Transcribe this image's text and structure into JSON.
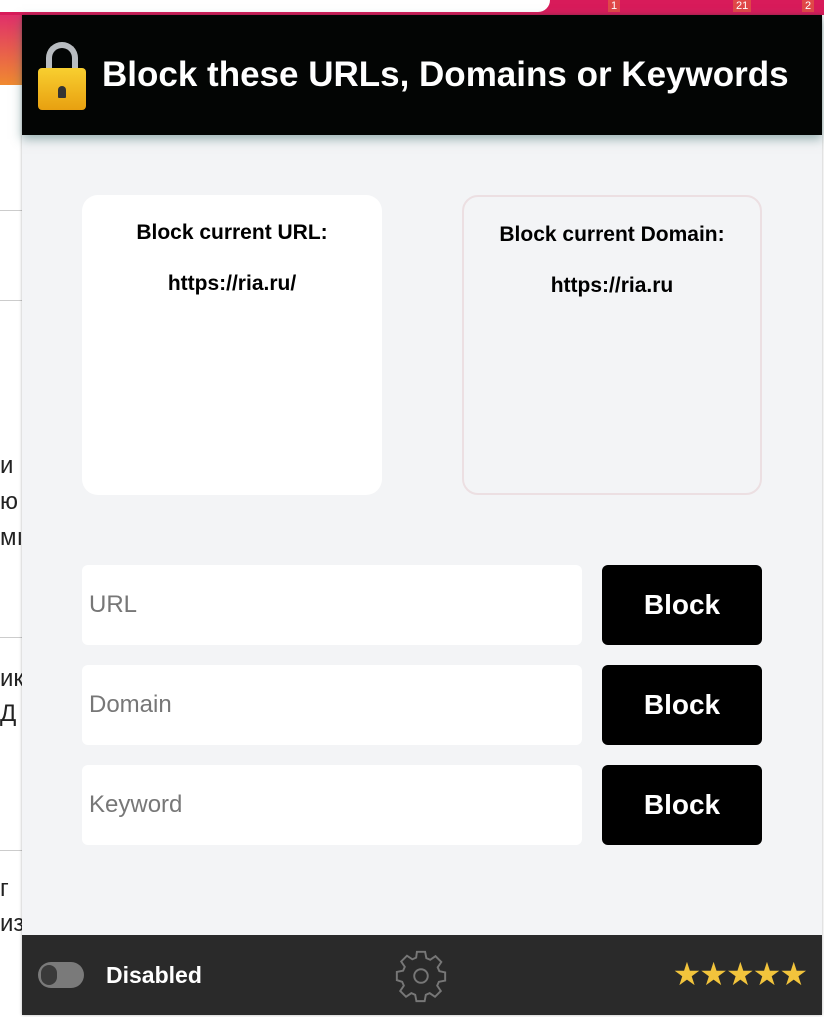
{
  "browser": {
    "badges": [
      "1",
      "21",
      "2"
    ]
  },
  "background_fragments": [
    "и",
    "ю",
    "мı",
    "ик",
    "Д",
    "г",
    "из"
  ],
  "header": {
    "title": "Block these URLs, Domains or Keywords",
    "icon": "lock-icon"
  },
  "cards": [
    {
      "label": "Block current URL:",
      "value": "https://ria.ru/"
    },
    {
      "label": "Block current Domain:",
      "value": "https://ria.ru"
    }
  ],
  "inputs": [
    {
      "placeholder": "URL",
      "value": "",
      "button": "Block"
    },
    {
      "placeholder": "Domain",
      "value": "",
      "button": "Block"
    },
    {
      "placeholder": "Keyword",
      "value": "",
      "button": "Block"
    }
  ],
  "footer": {
    "status": "Disabled",
    "enabled": false,
    "rating": 5,
    "rating_glyphs": "★★★★★",
    "star_color": "#f2c43c"
  }
}
